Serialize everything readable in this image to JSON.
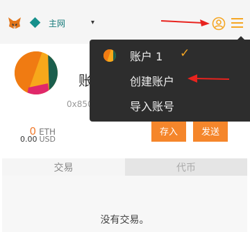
{
  "header": {
    "network_label": "主网",
    "network_caret": "▾"
  },
  "account": {
    "name": "账户 1",
    "address": "0x85071...",
    "eth_value": "0",
    "eth_unit": "ETH",
    "usd_value": "0.00",
    "usd_unit": "USD"
  },
  "actions": {
    "deposit_label": "存入",
    "send_label": "发送"
  },
  "tabs": {
    "transactions": "交易",
    "tokens": "代币"
  },
  "transactions": {
    "empty_text": "没有交易。"
  },
  "menu": {
    "account_label": "账户 1",
    "check": "✓",
    "create_label": "创建账户",
    "import_label": "导入账号"
  },
  "colors": {
    "accent": "#f5862b",
    "menu_bg": "#2d2d2d",
    "network": "#16908c",
    "arrow": "#e8231e"
  },
  "icons": [
    "metamask-fox-icon",
    "network-diamond-icon",
    "account-circle-icon",
    "hamburger-menu-icon",
    "check-icon"
  ]
}
